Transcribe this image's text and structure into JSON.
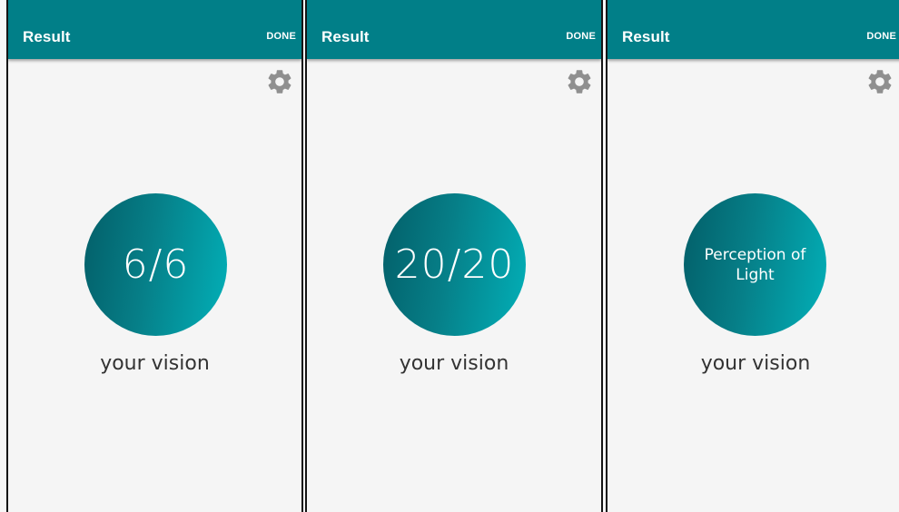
{
  "screens": [
    {
      "title": "Result",
      "done_label": "DONE",
      "settings_icon": "gear-icon",
      "score": "6/6",
      "caption": "your vision"
    },
    {
      "title": "Result",
      "done_label": "DONE",
      "settings_icon": "gear-icon",
      "score": "20/20",
      "caption": "your vision"
    },
    {
      "title": "Result",
      "done_label": "DONE",
      "settings_icon": "gear-icon",
      "score": "Perception of Light",
      "caption": "your vision"
    }
  ],
  "colors": {
    "appbar": "#017f88",
    "circle_dark": "#035e68",
    "circle_light": "#02b0b8",
    "background": "#f5f5f5",
    "gear": "#8f8f8f"
  }
}
